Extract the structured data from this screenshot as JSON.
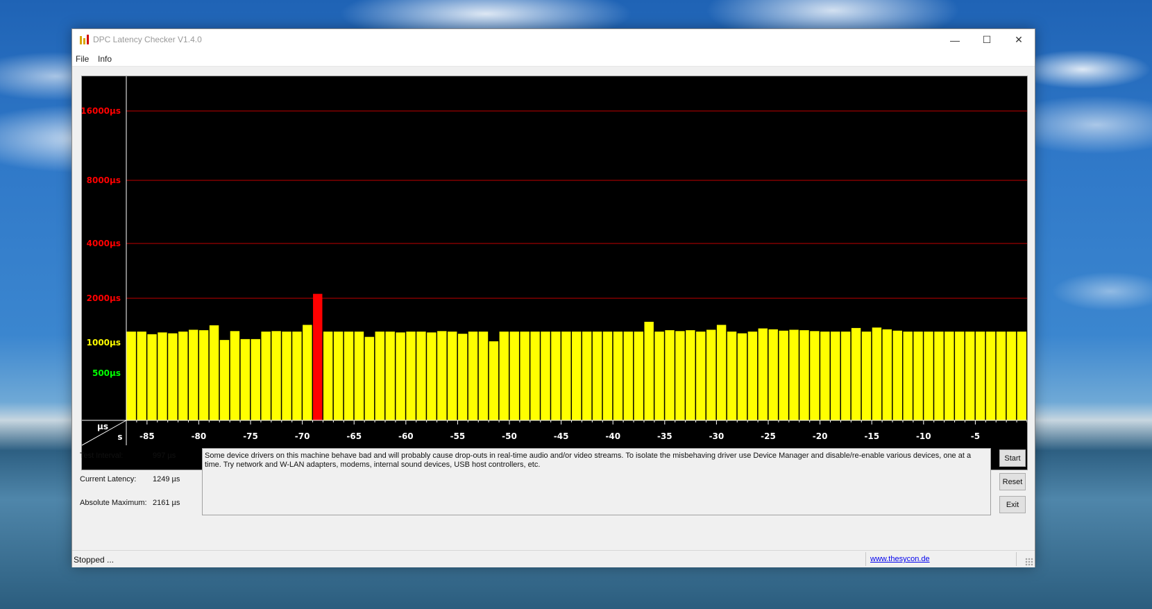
{
  "window": {
    "title": "DPC Latency Checker V1.4.0",
    "minimize_glyph": "—",
    "maximize_glyph": "☐",
    "close_glyph": "✕"
  },
  "menu": {
    "file": "File",
    "info": "Info"
  },
  "chart_data": {
    "type": "bar",
    "ylabel": "µs",
    "xlabel": "s",
    "y_tick_labels": [
      "16000µs",
      "8000µs",
      "4000µs",
      "2000µs",
      "1000µs",
      "500µs"
    ],
    "y_tick_values": [
      16000,
      8000,
      4000,
      2000,
      1000,
      500
    ],
    "y_tick_colors": [
      "#ff0000",
      "#ff0000",
      "#ff0000",
      "#ff0000",
      "#ffff00",
      "#00ff00"
    ],
    "red_gridlines_at": [
      16000,
      8000,
      4000,
      2000
    ],
    "x_tick_labels": [
      "-85",
      "-80",
      "-75",
      "-70",
      "-65",
      "-60",
      "-55",
      "-50",
      "-45",
      "-40",
      "-35",
      "-30",
      "-25",
      "-20",
      "-15",
      "-10",
      "-5"
    ],
    "x_tick_values": [
      -85,
      -80,
      -75,
      -70,
      -65,
      -60,
      -55,
      -50,
      -45,
      -40,
      -35,
      -30,
      -25,
      -20,
      -15,
      -10,
      -5
    ],
    "x_range": [
      -87,
      0
    ],
    "bar_x_start": -87,
    "bar_x_step": 1,
    "values": [
      1249,
      1249,
      1190,
      1230,
      1210,
      1249,
      1290,
      1280,
      1390,
      1060,
      1260,
      1080,
      1080,
      1249,
      1260,
      1249,
      1249,
      1400,
      2161,
      1249,
      1249,
      1249,
      1249,
      1130,
      1249,
      1249,
      1230,
      1249,
      1249,
      1230,
      1260,
      1249,
      1200,
      1249,
      1249,
      1030,
      1249,
      1249,
      1249,
      1249,
      1249,
      1249,
      1249,
      1249,
      1249,
      1249,
      1249,
      1249,
      1249,
      1249,
      1470,
      1249,
      1280,
      1260,
      1280,
      1249,
      1290,
      1400,
      1249,
      1210,
      1249,
      1320,
      1300,
      1270,
      1290,
      1280,
      1260,
      1249,
      1249,
      1249,
      1330,
      1249,
      1340,
      1300,
      1270,
      1249,
      1249,
      1249,
      1249,
      1249,
      1249,
      1249,
      1249,
      1249,
      1249,
      1249,
      1249
    ],
    "bar_colors": {
      "normal": "#ffff00",
      "over_2000": "#ff0000"
    }
  },
  "info": {
    "test_interval_label": "Test Interval:",
    "test_interval_value": "997 µs",
    "current_latency_label": "Current Latency:",
    "current_latency_value": "1249 µs",
    "absolute_maximum_label": "Absolute Maximum:",
    "absolute_maximum_value": "2161 µs"
  },
  "message": "Some device drivers on this machine behave bad and will probably cause drop-outs in real-time audio and/or video streams. To isolate the misbehaving driver use Device Manager and disable/re-enable various devices, one at a time. Try network and W-LAN adapters, modems, internal sound devices, USB host controllers, etc.",
  "buttons": {
    "start": "Start",
    "reset": "Reset",
    "exit": "Exit"
  },
  "status": {
    "text": "Stopped ...",
    "link": "www.thesycon.de"
  }
}
